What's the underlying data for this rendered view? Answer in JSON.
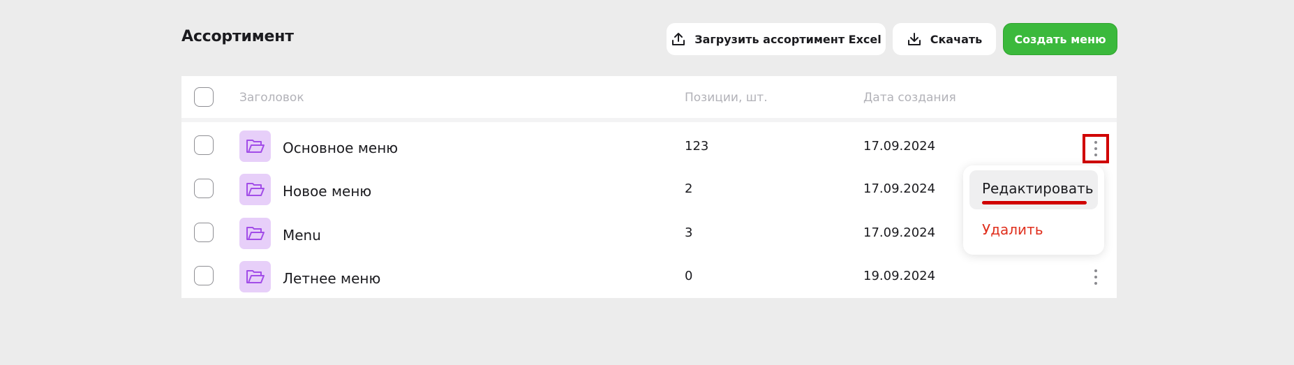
{
  "page": {
    "title": "Ассортимент"
  },
  "toolbar": {
    "upload_label": "Загрузить ассортимент Excel",
    "download_label": "Скачать",
    "create_label": "Создать меню",
    "primary_color": "#3bb93c"
  },
  "table": {
    "columns": [
      "Заголовок",
      "Позиции, шт.",
      "Дата создания"
    ],
    "rows": [
      {
        "title": "Основное меню",
        "count": "123",
        "date": "17.09.2024"
      },
      {
        "title": "Новое меню",
        "count": "2",
        "date": "17.09.2024"
      },
      {
        "title": "Menu",
        "count": "3",
        "date": "17.09.2024"
      },
      {
        "title": "Летнее меню",
        "count": "0",
        "date": "19.09.2024"
      }
    ],
    "row_icon": "folder-icon"
  },
  "context_menu": {
    "edit_label": "Редактировать",
    "delete_label": "Удалить",
    "delete_color": "#e0301e",
    "highlight_color": "#d00000"
  }
}
